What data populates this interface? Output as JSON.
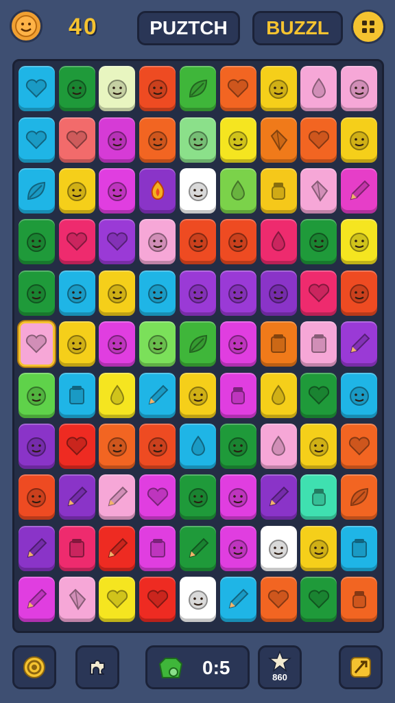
{
  "header": {
    "score": "40",
    "title_left": "PUZTCH",
    "title_right": "BUZZL"
  },
  "footer": {
    "moves": "0:5",
    "star_count": "860"
  },
  "colors": {
    "background": "#3e4f72",
    "board": "#242d45",
    "accent_gold": "#f5c330"
  },
  "board": {
    "rows": [
      [
        {
          "c": "#1fb5e6",
          "i": "heart"
        },
        {
          "c": "#1f9a3a",
          "i": "face"
        },
        {
          "c": "#e8f5c0",
          "i": "face"
        },
        {
          "c": "#ee4b22",
          "i": "face"
        },
        {
          "c": "#3fb63a",
          "i": "leaf"
        },
        {
          "c": "#f26522",
          "i": "heart"
        },
        {
          "c": "#f5cf1a",
          "i": "face"
        },
        {
          "c": "#f6a7d7",
          "i": "drop"
        },
        {
          "c": "#f6a7d7",
          "i": "face"
        }
      ],
      [
        {
          "c": "#1fb5e6",
          "i": "heart"
        },
        {
          "c": "#f26b6b",
          "i": "heart"
        },
        {
          "c": "#d63bd6",
          "i": "face"
        },
        {
          "c": "#f26522",
          "i": "face"
        },
        {
          "c": "#8be08a",
          "i": "face"
        },
        {
          "c": "#f5e520",
          "i": "face"
        },
        {
          "c": "#f07a1a",
          "i": "gem"
        },
        {
          "c": "#f26522",
          "i": "heart"
        },
        {
          "c": "#f5cf1a",
          "i": "face"
        }
      ],
      [
        {
          "c": "#1fb5e6",
          "i": "leaf"
        },
        {
          "c": "#f5cf1a",
          "i": "face"
        },
        {
          "c": "#e03ee0",
          "i": "face"
        },
        {
          "c": "#8a34c8",
          "i": "fire"
        },
        {
          "c": "#ffffff",
          "i": "face"
        },
        {
          "c": "#7bd24a",
          "i": "drop"
        },
        {
          "c": "#f5c81a",
          "i": "jar"
        },
        {
          "c": "#f6a7d7",
          "i": "gem"
        },
        {
          "c": "#e63ec8",
          "i": "pencil"
        }
      ],
      [
        {
          "c": "#1f9a3a",
          "i": "face"
        },
        {
          "c": "#ee2b6e",
          "i": "heart"
        },
        {
          "c": "#9a3ad6",
          "i": "heart"
        },
        {
          "c": "#f6a7d7",
          "i": "face"
        },
        {
          "c": "#ee4b22",
          "i": "face"
        },
        {
          "c": "#ee4b22",
          "i": "face"
        },
        {
          "c": "#ee2b6e",
          "i": "drop"
        },
        {
          "c": "#1f9a3a",
          "i": "face"
        },
        {
          "c": "#f5e520",
          "i": "face"
        }
      ],
      [
        {
          "c": "#1f9a3a",
          "i": "face"
        },
        {
          "c": "#1fb5e6",
          "i": "face"
        },
        {
          "c": "#f5cf1a",
          "i": "face"
        },
        {
          "c": "#1fb5e6",
          "i": "face"
        },
        {
          "c": "#9a3ad6",
          "i": "face"
        },
        {
          "c": "#9a3ad6",
          "i": "face"
        },
        {
          "c": "#8a34c8",
          "i": "face"
        },
        {
          "c": "#ee2b6e",
          "i": "heart"
        },
        {
          "c": "#ee4b22",
          "i": "face"
        }
      ],
      [
        {
          "c": "#f6a7d7",
          "i": "heart",
          "sel": true
        },
        {
          "c": "#f5cf1a",
          "i": "face"
        },
        {
          "c": "#e03ee0",
          "i": "face"
        },
        {
          "c": "#7be05a",
          "i": "face"
        },
        {
          "c": "#3fb63a",
          "i": "leaf"
        },
        {
          "c": "#e03ee0",
          "i": "face"
        },
        {
          "c": "#f07a1a",
          "i": "box"
        },
        {
          "c": "#f6a7d7",
          "i": "box"
        },
        {
          "c": "#9a3ad6",
          "i": "pencil"
        }
      ],
      [
        {
          "c": "#5fd24a",
          "i": "face"
        },
        {
          "c": "#1fb5e6",
          "i": "box"
        },
        {
          "c": "#f5e520",
          "i": "drop"
        },
        {
          "c": "#1fb5e6",
          "i": "pencil"
        },
        {
          "c": "#f5cf1a",
          "i": "face"
        },
        {
          "c": "#e03ee0",
          "i": "jar"
        },
        {
          "c": "#f5cf1a",
          "i": "drop"
        },
        {
          "c": "#1f9a3a",
          "i": "heart"
        },
        {
          "c": "#1fb5e6",
          "i": "face"
        }
      ],
      [
        {
          "c": "#8a34c8",
          "i": "face"
        },
        {
          "c": "#ee2b22",
          "i": "heart"
        },
        {
          "c": "#f26522",
          "i": "face"
        },
        {
          "c": "#ee4b22",
          "i": "face"
        },
        {
          "c": "#1fb5e6",
          "i": "drop"
        },
        {
          "c": "#1f9a3a",
          "i": "face"
        },
        {
          "c": "#f6a7d7",
          "i": "drop"
        },
        {
          "c": "#f5cf1a",
          "i": "face"
        },
        {
          "c": "#f26522",
          "i": "heart"
        }
      ],
      [
        {
          "c": "#ee4b22",
          "i": "face"
        },
        {
          "c": "#8a34c8",
          "i": "pencil"
        },
        {
          "c": "#f6a7d7",
          "i": "pencil"
        },
        {
          "c": "#e03ee0",
          "i": "heart"
        },
        {
          "c": "#1f9a3a",
          "i": "face"
        },
        {
          "c": "#e03ee0",
          "i": "face"
        },
        {
          "c": "#8a34c8",
          "i": "pencil"
        },
        {
          "c": "#3fe0b0",
          "i": "jar"
        },
        {
          "c": "#f26522",
          "i": "leaf"
        }
      ],
      [
        {
          "c": "#8a34c8",
          "i": "pencil"
        },
        {
          "c": "#ee2b6e",
          "i": "box"
        },
        {
          "c": "#ee2b22",
          "i": "pencil"
        },
        {
          "c": "#e03ee0",
          "i": "box"
        },
        {
          "c": "#1f9a3a",
          "i": "pencil"
        },
        {
          "c": "#e03ee0",
          "i": "face"
        },
        {
          "c": "#ffffff",
          "i": "face"
        },
        {
          "c": "#f5cf1a",
          "i": "face"
        },
        {
          "c": "#1fb5e6",
          "i": "box"
        }
      ],
      [
        {
          "c": "#e03ee0",
          "i": "pencil"
        },
        {
          "c": "#f6a7d7",
          "i": "gem"
        },
        {
          "c": "#f5e520",
          "i": "heart"
        },
        {
          "c": "#ee2b22",
          "i": "heart"
        },
        {
          "c": "#ffffff",
          "i": "face"
        },
        {
          "c": "#1fb5e6",
          "i": "pencil"
        },
        {
          "c": "#f26522",
          "i": "heart"
        },
        {
          "c": "#1f9a3a",
          "i": "heart"
        },
        {
          "c": "#f26522",
          "i": "jar"
        }
      ]
    ]
  }
}
